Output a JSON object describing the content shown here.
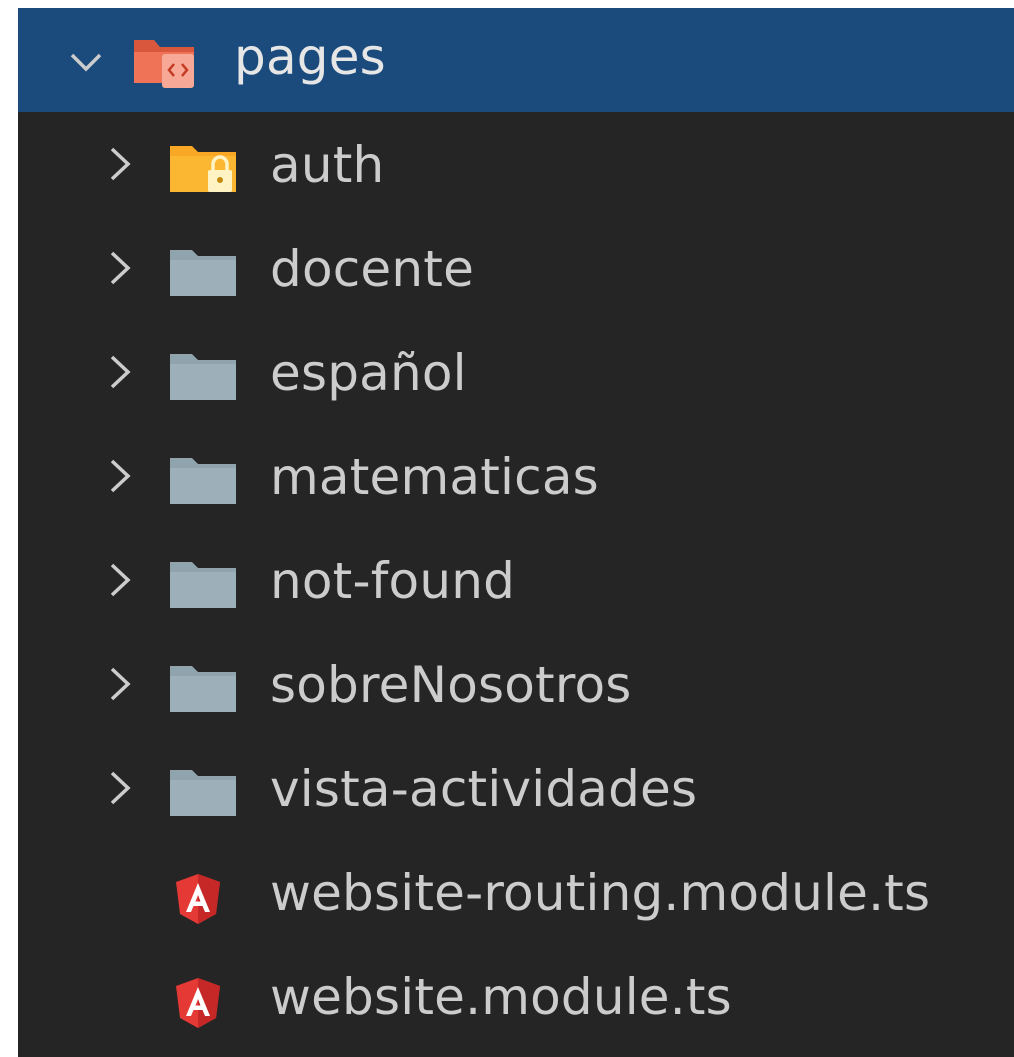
{
  "explorer": {
    "root": {
      "label": "pages",
      "expanded": true,
      "icon": "folder-open-views-icon"
    },
    "items": [
      {
        "label": "auth",
        "type": "folder",
        "icon": "folder-lock-icon"
      },
      {
        "label": "docente",
        "type": "folder",
        "icon": "folder-icon"
      },
      {
        "label": "español",
        "type": "folder",
        "icon": "folder-icon"
      },
      {
        "label": "matematicas",
        "type": "folder",
        "icon": "folder-icon"
      },
      {
        "label": "not-found",
        "type": "folder",
        "icon": "folder-icon"
      },
      {
        "label": "sobreNosotros",
        "type": "folder",
        "icon": "folder-icon"
      },
      {
        "label": "vista-actividades",
        "type": "folder",
        "icon": "folder-icon"
      },
      {
        "label": "website-routing.module.ts",
        "type": "file",
        "icon": "angular-icon"
      },
      {
        "label": "website.module.ts",
        "type": "file",
        "icon": "angular-icon"
      }
    ]
  },
  "colors": {
    "background": "#252526",
    "selected_row": "#1b4b7c",
    "text": "#cccccc",
    "folder_gray": "#90a4ae",
    "folder_lock_yellow": "#f9a825",
    "pages_folder_orange": "#e8674a",
    "angular_red": "#e53935"
  }
}
